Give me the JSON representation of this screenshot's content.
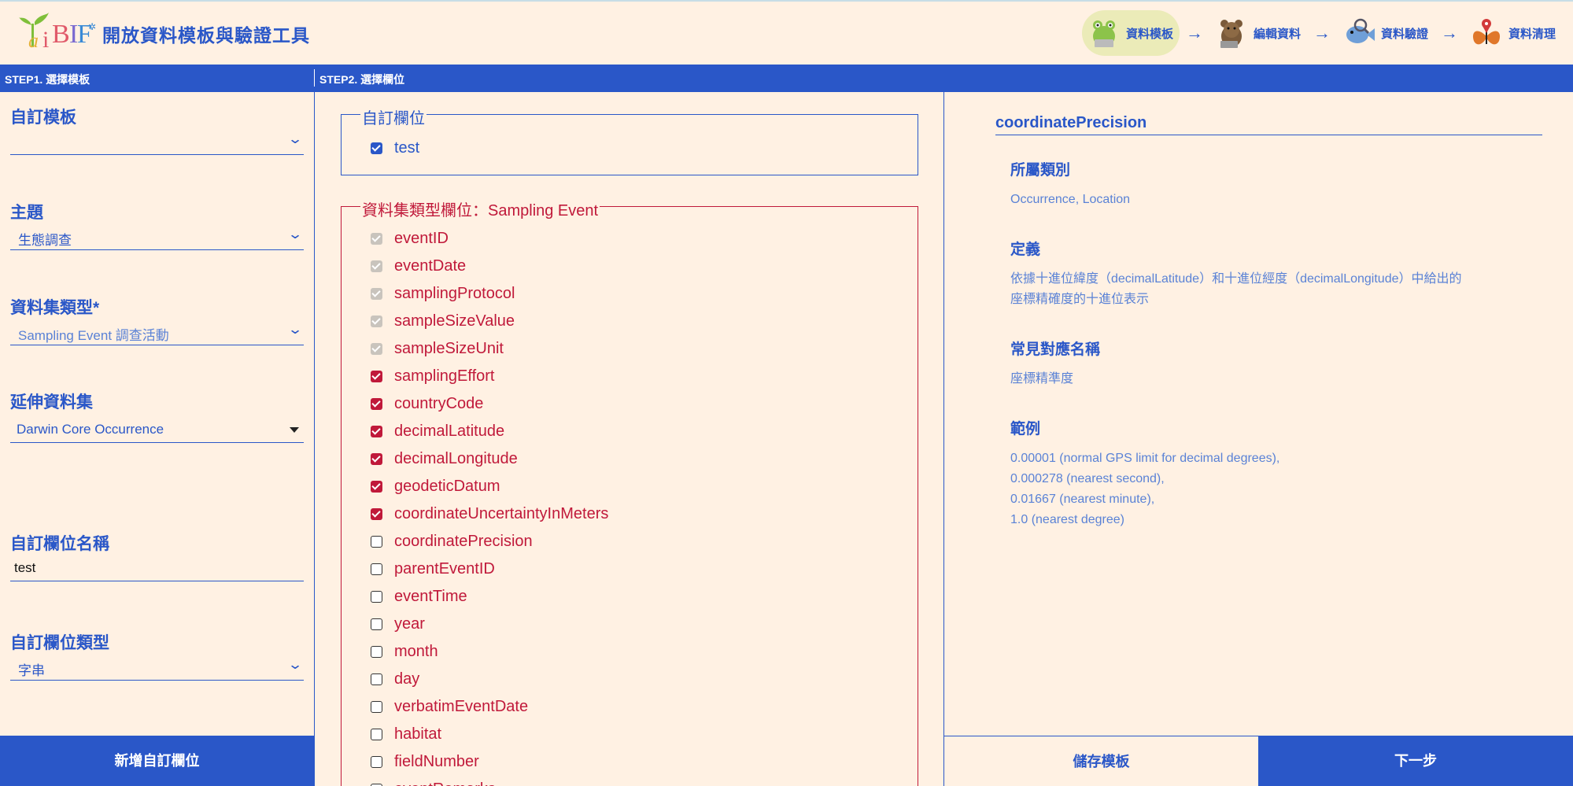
{
  "header": {
    "title": "開放資料模板與驗證工具",
    "logo_text": "TaiBIF",
    "steps": [
      {
        "label": "資料模板",
        "icon": "frog-laptop-icon",
        "active": true
      },
      {
        "label": "編輯資料",
        "icon": "bear-laptop-icon",
        "active": false
      },
      {
        "label": "資料驗證",
        "icon": "fish-magnifier-icon",
        "active": false
      },
      {
        "label": "資料清理",
        "icon": "butterfly-pin-icon",
        "active": false
      }
    ],
    "arrow": "→"
  },
  "stepbar": {
    "step1": "STEP1. 選擇模板",
    "step2": "STEP2. 選擇欄位"
  },
  "left": {
    "custom_template": {
      "label": "自訂模板",
      "value": ""
    },
    "theme": {
      "label": "主題",
      "value": "生態調查"
    },
    "dataset_type": {
      "label": "資料集類型*",
      "value": "Sampling Event 調查活動"
    },
    "extension": {
      "label": "延伸資料集",
      "value": "Darwin Core Occurrence"
    },
    "custom_field_name": {
      "label": "自訂欄位名稱",
      "value": "test"
    },
    "custom_field_type": {
      "label": "自訂欄位類型",
      "value": "字串"
    },
    "add_button": "新增自訂欄位"
  },
  "middle": {
    "custom_fieldset": {
      "legend": "自訂欄位",
      "fields": [
        {
          "label": "test",
          "state": "checked"
        }
      ]
    },
    "sampling_fieldset": {
      "legend": "資料集類型欄位：Sampling Event",
      "fields": [
        {
          "label": "eventID",
          "state": "disabled"
        },
        {
          "label": "eventDate",
          "state": "disabled"
        },
        {
          "label": "samplingProtocol",
          "state": "disabled"
        },
        {
          "label": "sampleSizeValue",
          "state": "disabled"
        },
        {
          "label": "sampleSizeUnit",
          "state": "disabled"
        },
        {
          "label": "samplingEffort",
          "state": "checked"
        },
        {
          "label": "countryCode",
          "state": "checked"
        },
        {
          "label": "decimalLatitude",
          "state": "checked"
        },
        {
          "label": "decimalLongitude",
          "state": "checked"
        },
        {
          "label": "geodeticDatum",
          "state": "checked"
        },
        {
          "label": "coordinateUncertaintyInMeters",
          "state": "checked"
        },
        {
          "label": "coordinatePrecision",
          "state": "unchecked"
        },
        {
          "label": "parentEventID",
          "state": "unchecked"
        },
        {
          "label": "eventTime",
          "state": "unchecked"
        },
        {
          "label": "year",
          "state": "unchecked"
        },
        {
          "label": "month",
          "state": "unchecked"
        },
        {
          "label": "day",
          "state": "unchecked"
        },
        {
          "label": "verbatimEventDate",
          "state": "unchecked"
        },
        {
          "label": "habitat",
          "state": "unchecked"
        },
        {
          "label": "fieldNumber",
          "state": "unchecked"
        },
        {
          "label": "eventRemarks",
          "state": "unchecked"
        }
      ]
    }
  },
  "right": {
    "term": "coordinatePrecision",
    "sections": [
      {
        "heading": "所屬類別",
        "text": [
          "Occurrence, Location"
        ]
      },
      {
        "heading": "定義",
        "text": [
          "依據十進位緯度（decimalLatitude）和十進位經度（decimalLongitude）中給出的",
          "座標精確度的十進位表示"
        ]
      },
      {
        "heading": "常見對應名稱",
        "text": [
          "座標精準度"
        ]
      },
      {
        "heading": "範例",
        "text": [
          "0.00001 (normal GPS limit for decimal degrees),",
          "0.000278 (nearest second),",
          "0.01667 (nearest minute),",
          "1.0 (nearest degree)"
        ]
      }
    ],
    "save_button": "儲存模板",
    "next_button": "下一步"
  },
  "colors": {
    "background": "#fff1e3",
    "primary": "#2a57c8",
    "accent_red": "#c0193a",
    "active_step": "#ebebb8"
  }
}
